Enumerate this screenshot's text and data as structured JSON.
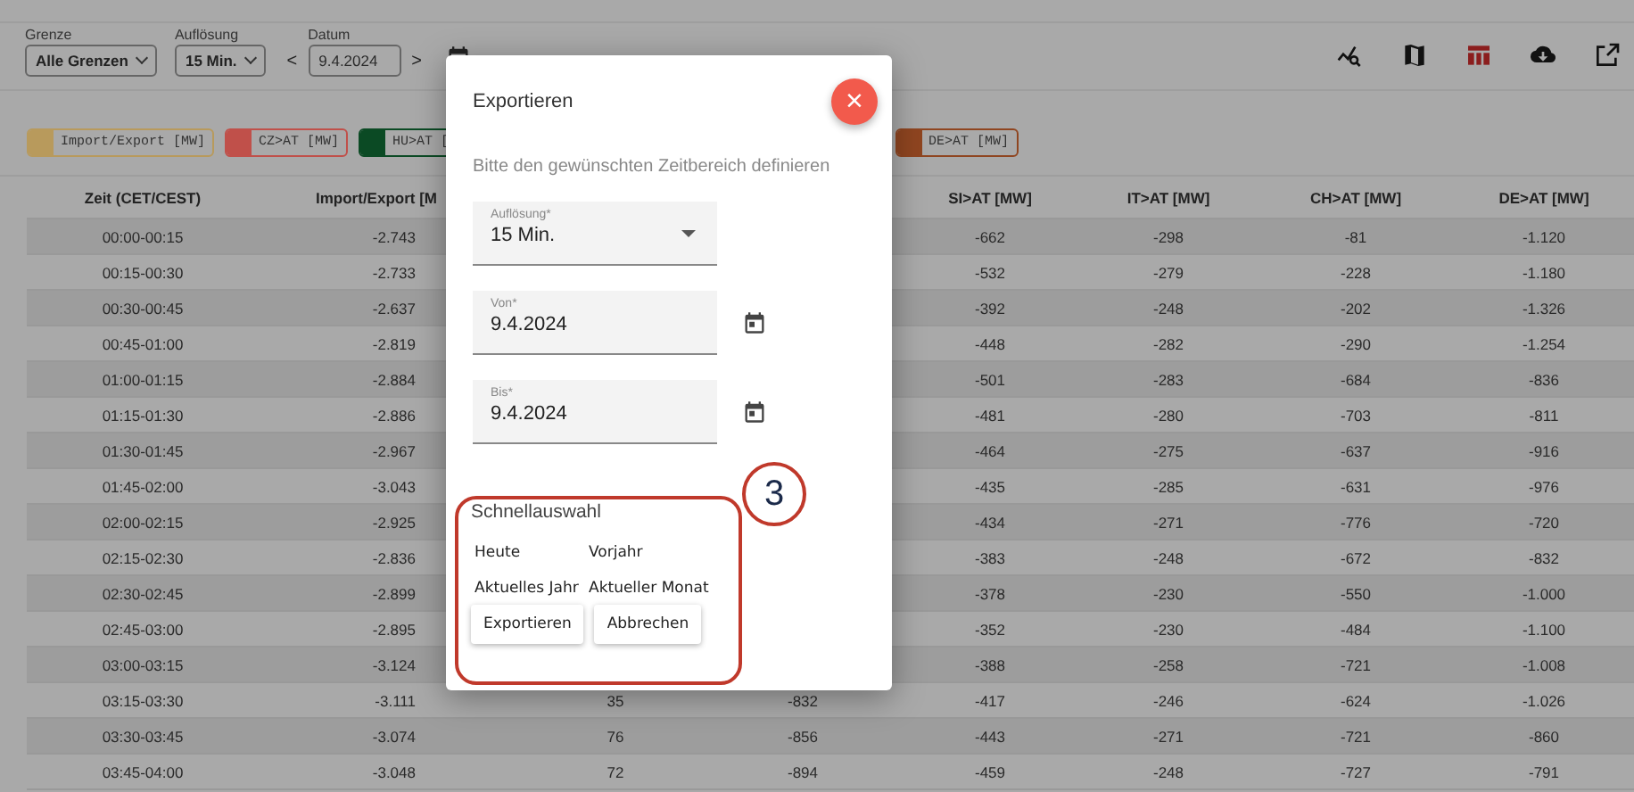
{
  "toolbar": {
    "filters": [
      {
        "label": "Grenze",
        "value": "Alle Grenzen"
      },
      {
        "label": "Auflösung",
        "value": "15 Min."
      }
    ],
    "date": {
      "label": "Datum",
      "value": "9.4.2024",
      "prev": "<",
      "next": ">"
    },
    "views": [
      {
        "selected": false
      },
      {
        "selected": false
      },
      {
        "selected": true
      },
      {
        "selected": false
      },
      {
        "selected": false
      }
    ]
  },
  "legend": [
    {
      "label": "Import/Export [MW]",
      "color": "#b89a5c"
    },
    {
      "label": "CZ>AT [MW]",
      "color": "#c0504a"
    },
    {
      "label": "HU>AT [",
      "color": "#0b4a24"
    },
    {
      "label": "DE>AT [MW]",
      "color": "#8f4520"
    }
  ],
  "table": {
    "columns": [
      "Zeit (CET/CEST)",
      "Import/Export [M",
      null,
      null,
      "SI>AT [MW]",
      "IT>AT [MW]",
      "CH>AT [MW]",
      "DE>AT [MW]"
    ],
    "rows": [
      {
        "cells": [
          "00:00-00:15",
          "-2.743",
          null,
          null,
          "-662",
          "-298",
          "-81",
          "-1.120"
        ]
      },
      {
        "cells": [
          "00:15-00:30",
          "-2.733",
          null,
          null,
          "-532",
          "-279",
          "-228",
          "-1.180"
        ]
      },
      {
        "cells": [
          "00:30-00:45",
          "-2.637",
          null,
          null,
          "-392",
          "-248",
          "-202",
          "-1.326"
        ]
      },
      {
        "cells": [
          "00:45-01:00",
          "-2.819",
          null,
          null,
          "-448",
          "-282",
          "-290",
          "-1.254"
        ]
      },
      {
        "cells": [
          "01:00-01:15",
          "-2.884",
          null,
          null,
          "-501",
          "-283",
          "-684",
          "-836"
        ]
      },
      {
        "cells": [
          "01:15-01:30",
          "-2.886",
          null,
          null,
          "-481",
          "-280",
          "-703",
          "-811"
        ]
      },
      {
        "cells": [
          "01:30-01:45",
          "-2.967",
          null,
          null,
          "-464",
          "-275",
          "-637",
          "-916"
        ]
      },
      {
        "cells": [
          "01:45-02:00",
          "-3.043",
          null,
          null,
          "-435",
          "-285",
          "-631",
          "-976"
        ]
      },
      {
        "cells": [
          "02:00-02:15",
          "-2.925",
          null,
          null,
          "-434",
          "-271",
          "-776",
          "-720"
        ]
      },
      {
        "cells": [
          "02:15-02:30",
          "-2.836",
          null,
          null,
          "-383",
          "-248",
          "-672",
          "-832"
        ]
      },
      {
        "cells": [
          "02:30-02:45",
          "-2.899",
          null,
          null,
          "-378",
          "-230",
          "-550",
          "-1.000"
        ]
      },
      {
        "cells": [
          "02:45-03:00",
          "-2.895",
          null,
          null,
          "-352",
          "-230",
          "-484",
          "-1.100"
        ]
      },
      {
        "cells": [
          "03:00-03:15",
          "-3.124",
          null,
          null,
          "-388",
          "-258",
          "-721",
          "-1.008"
        ]
      },
      {
        "cells": [
          "03:15-03:30",
          "-3.111",
          "35",
          "-832",
          "-417",
          "-246",
          "-624",
          "-1.026"
        ]
      },
      {
        "cells": [
          "03:30-03:45",
          "-3.074",
          "76",
          "-856",
          "-443",
          "-271",
          "-721",
          "-860"
        ]
      },
      {
        "cells": [
          "03:45-04:00",
          "-3.048",
          "72",
          "-894",
          "-459",
          "-248",
          "-727",
          "-791"
        ]
      }
    ]
  },
  "dialog": {
    "title": "Exportieren",
    "close": "×",
    "subtitle": "Bitte den gewünschten Zeitbereich definieren",
    "fields": [
      {
        "kind": "select",
        "label": "Auflösung*",
        "value": "15 Min."
      },
      {
        "kind": "date",
        "label": "Von*",
        "value": "9.4.2024"
      },
      {
        "kind": "date",
        "label": "Bis*",
        "value": "9.4.2024"
      }
    ],
    "quick": {
      "title": "Schnellauswahl",
      "options": [
        "Heute",
        "Vorjahr",
        "Aktuelles Jahr",
        "Aktueller Monat"
      ]
    },
    "buttons": [
      "Exportieren",
      "Abbrechen"
    ]
  },
  "annotation": {
    "number": "3"
  }
}
